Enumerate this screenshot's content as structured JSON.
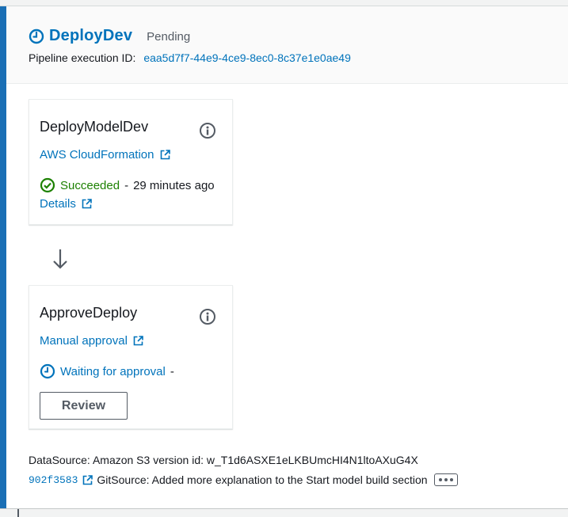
{
  "stage": {
    "title": "DeployDev",
    "status": "Pending",
    "execution_label": "Pipeline execution ID:",
    "execution_id": "eaa5d7f7-44e9-4ce9-8ec0-8c37e1e0ae49",
    "title_icon": "clock-icon"
  },
  "actions": [
    {
      "name": "DeployModelDev",
      "provider": "AWS CloudFormation",
      "status": "Succeeded",
      "separator": "-",
      "time_ago": "29 minutes ago",
      "details_label": "Details",
      "status_icon": "check-circle-icon"
    },
    {
      "name": "ApproveDeploy",
      "provider": "Manual approval",
      "status": "Waiting for approval",
      "separator": "-",
      "button_label": "Review",
      "status_icon": "clock-icon"
    }
  ],
  "footer": {
    "datasource": "DataSource: Amazon S3 version id: w_T1d6ASXE1eLKBUmcHI4N1ltoAXuG4X",
    "commit_id": "902f3583",
    "git_source": "GitSource: Added more explanation to the Start model build section"
  },
  "colors": {
    "accent": "#1a6fb5",
    "link": "#0073bb",
    "success": "#1d8102",
    "muted": "#545b64"
  }
}
